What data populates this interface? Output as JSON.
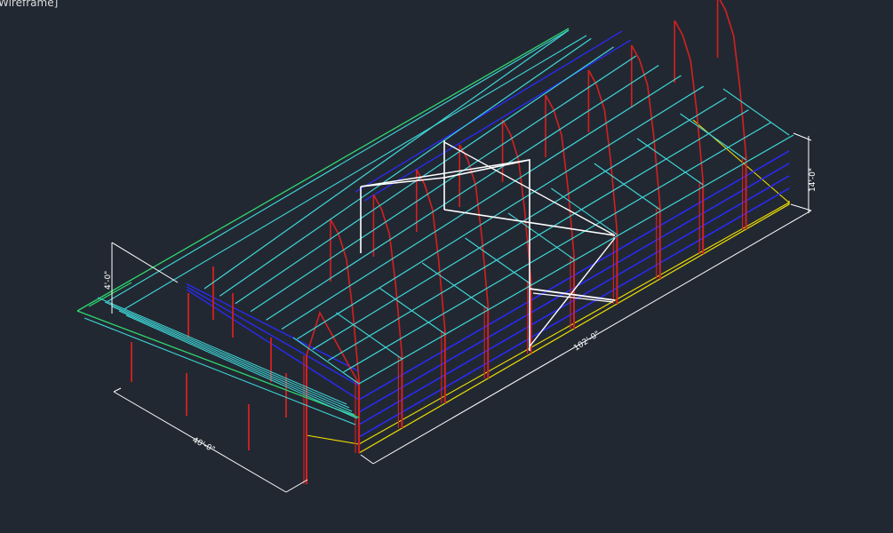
{
  "viewport": {
    "view_label": "Wireframe]",
    "background": "#222832"
  },
  "dimensions": {
    "width": "40'-0\"",
    "length": "102'-0\"",
    "eave_height": "14'-0\"",
    "canopy_height": "4'-0\""
  },
  "colors": {
    "frames": "#d42020",
    "purlins": "#3fd8d8",
    "girts": "#2a2aff",
    "bracing": "#ffffff",
    "base_line": "#f0e000",
    "edge_trim": "#2fd870",
    "dimension_lines": "#ffffff"
  }
}
